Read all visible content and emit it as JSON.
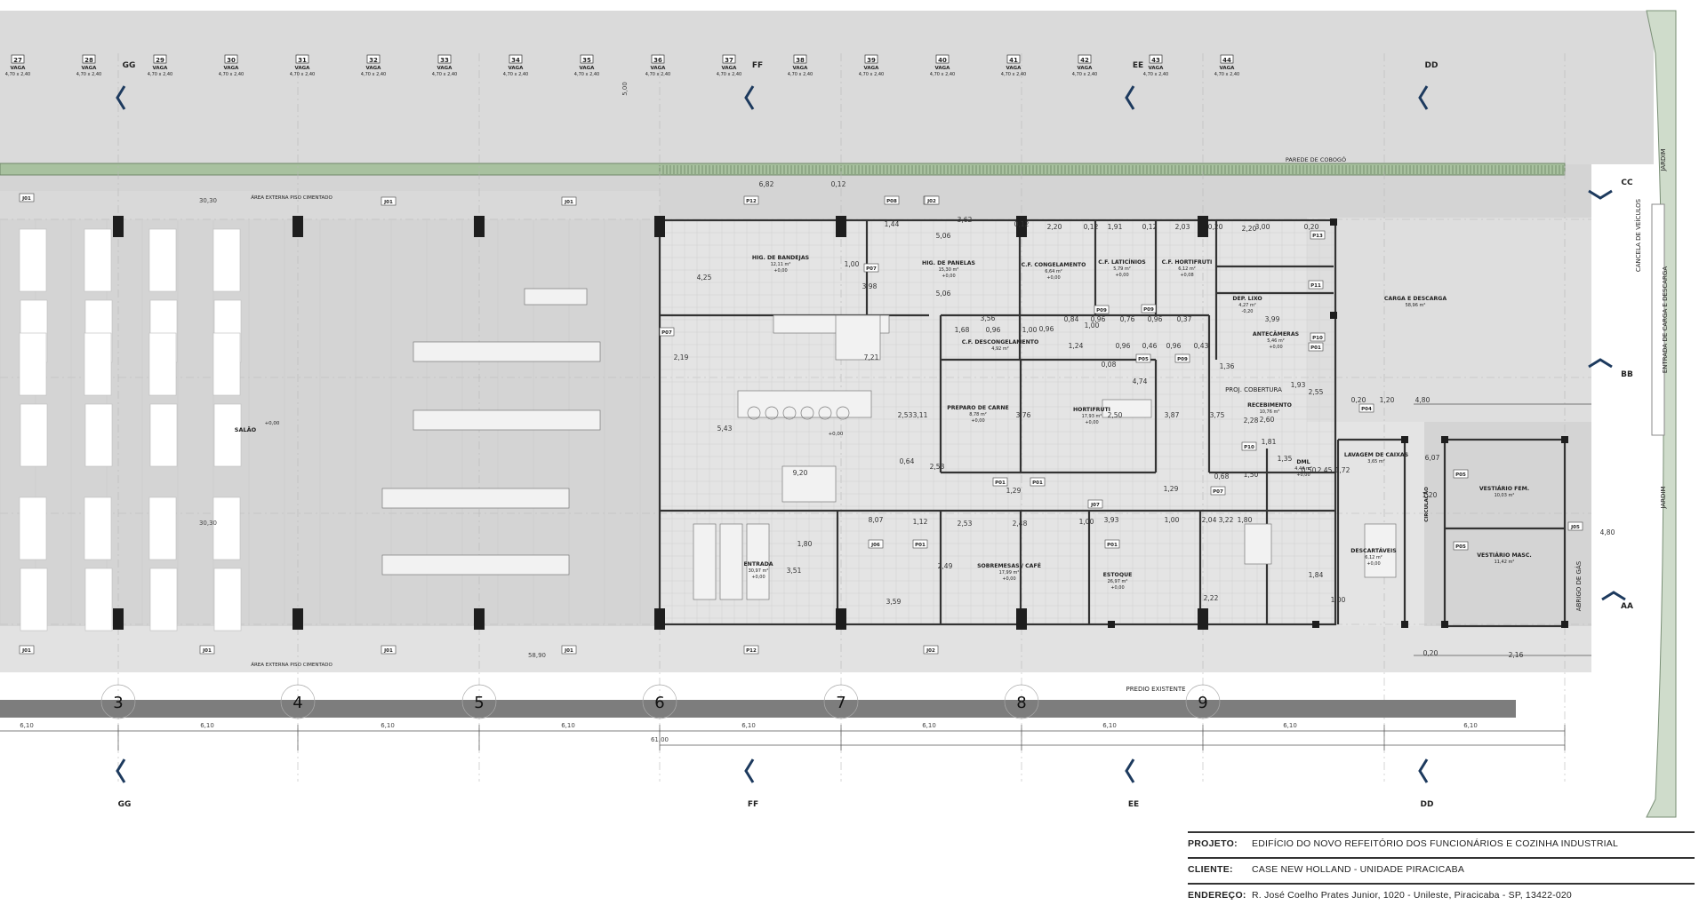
{
  "grid_top": [
    {
      "label": "27",
      "sub": "VAGA",
      "dim": "4,70 x 2,40"
    },
    {
      "label": "28",
      "sub": "VAGA",
      "dim": "4,70 x 2,40"
    },
    {
      "label": "29",
      "sub": "VAGA",
      "dim": "4,70 x 2,40"
    },
    {
      "label": "30",
      "sub": "VAGA",
      "dim": "4,70 x 2,40"
    },
    {
      "label": "31",
      "sub": "VAGA",
      "dim": "4,70 x 2,40"
    },
    {
      "label": "32",
      "sub": "VAGA",
      "dim": "4,70 x 2,40"
    },
    {
      "label": "33",
      "sub": "VAGA",
      "dim": "4,70 x 2,40"
    },
    {
      "label": "34",
      "sub": "VAGA",
      "dim": "4,70 x 2,40"
    },
    {
      "label": "35",
      "sub": "VAGA",
      "dim": "4,70 x 2,40"
    },
    {
      "label": "36",
      "sub": "VAGA",
      "dim": "4,70 x 2,40"
    },
    {
      "label": "37",
      "sub": "VAGA",
      "dim": "4,70 x 2,40"
    },
    {
      "label": "38",
      "sub": "VAGA",
      "dim": "4,70 x 2,40"
    },
    {
      "label": "39",
      "sub": "VAGA",
      "dim": "4,70 x 2,40"
    },
    {
      "label": "40",
      "sub": "VAGA",
      "dim": "4,70 x 2,40"
    },
    {
      "label": "41",
      "sub": "VAGA",
      "dim": "4,70 x 2,40"
    },
    {
      "label": "42",
      "sub": "VAGA",
      "dim": "4,70 x 2,40"
    },
    {
      "label": "43",
      "sub": "VAGA",
      "dim": "4,70 x 2,40"
    },
    {
      "label": "44",
      "sub": "VAGA",
      "dim": "4,70 x 2,40"
    }
  ],
  "section_marks": [
    "GG",
    "FF",
    "EE",
    "DD"
  ],
  "section_marks_h": [
    "CC",
    "BB",
    "AA"
  ],
  "column_axes": [
    "3",
    "4",
    "5",
    "6",
    "7",
    "8",
    "9"
  ],
  "bay_dims": [
    "6,10",
    "6,10",
    "6,10",
    "6,10",
    "6,10",
    "6,10",
    "6,10",
    "6,10",
    "6,10"
  ],
  "overall_dims": {
    "total_top": "30,30",
    "total_mid": "30,30",
    "length": "58,90",
    "axis_total": "61,00",
    "parking_depth": "5,00"
  },
  "labels": {
    "parede": "PAREDE DE COBOGÓ",
    "area_externa_top": "ÁREA EXTERNA PISO CIMENTADO",
    "area_externa_bottom": "ÁREA EXTERNA PISO CIMENTADO",
    "predio": "PREDIO EXISTENTE",
    "proj_cobertura": "PROJ. COBERTURA",
    "jardim_top": "JARDIM",
    "jardim_bottom": "JARDIM",
    "cancela": "CANCELA DE VEÍCULOS",
    "entrada_carga": "ENTRADA DE CARGA E DESCARGA",
    "abrigo": "ABRIGO DE GÁS",
    "salao": "SALÃO",
    "salao_level": "+0,00",
    "circulacao": "CIRCULAÇÃO"
  },
  "rooms": [
    {
      "name": "HIG. DE BANDEJAS",
      "area": "12,11 m²",
      "level": "+0,00"
    },
    {
      "name": "HIG. DE PANELAS",
      "area": "15,30 m²",
      "level": "+0,00"
    },
    {
      "name": "C.F. CONGELAMENTO",
      "area": "6,64 m²",
      "level": "+0,00"
    },
    {
      "name": "C.F. LATICÍNIOS",
      "area": "5,79 m²",
      "level": "+0,00"
    },
    {
      "name": "C.F. HORTIFRUTI",
      "area": "6,12 m²",
      "level": "+0,08"
    },
    {
      "name": "DEP. LIXO",
      "area": "4,27 m²",
      "level": "-0,20"
    },
    {
      "name": "CARGA E DESCARGA",
      "area": "58,96 m²",
      "level": ""
    },
    {
      "name": "ANTECÂMERAS",
      "area": "5,46 m²",
      "level": "+0,00"
    },
    {
      "name": "C.F. DESCONGELAMENTO",
      "area": "4,92 m²",
      "level": ""
    },
    {
      "name": "PREPARO DE CARNE",
      "area": "8,78 m²",
      "level": "+0,00"
    },
    {
      "name": "HORTIFRUTI",
      "area": "17,93 m²",
      "level": "+0,00"
    },
    {
      "name": "RECEBIMENTO",
      "area": "10,76 m²",
      "level": ""
    },
    {
      "name": "LAVAGEM DE CAIXAS",
      "area": "3,65 m²",
      "level": ""
    },
    {
      "name": "DML",
      "area": "4,44 m²",
      "level": "+0,00"
    },
    {
      "name": "VESTIÁRIO FEM.",
      "area": "10,03 m²",
      "level": ""
    },
    {
      "name": "VESTIÁRIO MASC.",
      "area": "11,42 m²",
      "level": ""
    },
    {
      "name": "DESCARTÁVEIS",
      "area": "6,12 m²",
      "level": "+0,00"
    },
    {
      "name": "ENTRADA",
      "area": "30,97 m²",
      "level": "+0,00"
    },
    {
      "name": "SOBREMESAS / CAFÉ",
      "area": "17,99 m²",
      "level": "+0,00"
    },
    {
      "name": "ESTOQUE",
      "area": "26,97 m²",
      "level": "+0,00"
    }
  ],
  "kitchen_level": "+0,00",
  "door_tags": [
    "J01",
    "J01",
    "J01",
    "P12",
    "J02",
    "P08",
    "J02",
    "P07",
    "P07",
    "P13",
    "P11",
    "P10",
    "P04",
    "P01",
    "P09",
    "P09",
    "P05",
    "P09",
    "P10",
    "P07",
    "P01",
    "P01",
    "P01",
    "J07",
    "J06",
    "P01",
    "J05",
    "P05",
    "P05",
    "J01",
    "J01",
    "J01",
    "J01",
    "P12",
    "J02"
  ],
  "interior_dims": [
    "6,82",
    "0,12",
    "1,44",
    "3,62",
    "0,12",
    "2,20",
    "0,12",
    "1,91",
    "0,12",
    "2,03",
    "0,20",
    "3,00",
    "0,20",
    "2,20",
    "4,25",
    "1,00",
    "3,98",
    "5,06",
    "5,06",
    "1,68",
    "0,96",
    "1,00",
    "3,56",
    "7,21",
    "2,19",
    "5,43",
    "9,20",
    "0,96",
    "0,84",
    "0,96",
    "0,76",
    "0,96",
    "0,37",
    "1,24",
    "0,96",
    "0,46",
    "0,96",
    "0,43",
    "3,99",
    "1,00",
    "0,08",
    "4,74",
    "1,36",
    "3,11",
    "2,53",
    "3,76",
    "2,50",
    "3,87",
    "3,75",
    "2,28",
    "2,60",
    "1,93",
    "2,55",
    "0,20",
    "1,20",
    "4,80",
    "1,81",
    "1,72",
    "0,64",
    "2,53",
    "1,29",
    "1,29",
    "0,68",
    "1,50",
    "1,35",
    "2,45",
    "0,50",
    "1,80",
    "3,51",
    "1,12",
    "2,53",
    "2,48",
    "1,00",
    "3,93",
    "1,00",
    "2,04",
    "3,22",
    "1,80",
    "3,59",
    "8,07",
    "2,49",
    "2,22",
    "1,84",
    "1,00",
    "6,07",
    "1,20",
    "4,80",
    "0,20",
    "2,16"
  ],
  "title_block": {
    "projeto_label": "PROJETO:",
    "projeto": "EDIFÍCIO DO NOVO REFEITÓRIO DOS FUNCIONÁRIOS E COZINHA INDUSTRIAL",
    "cliente_label": "CLIENTE:",
    "cliente": "CASE NEW HOLLAND - UNIDADE PIRACICABA",
    "endereco_label": "ENDEREÇO:",
    "endereco": "R. José Coelho Prates Junior, 1020 - Unileste, Piracicaba - SP, 13422-020"
  }
}
